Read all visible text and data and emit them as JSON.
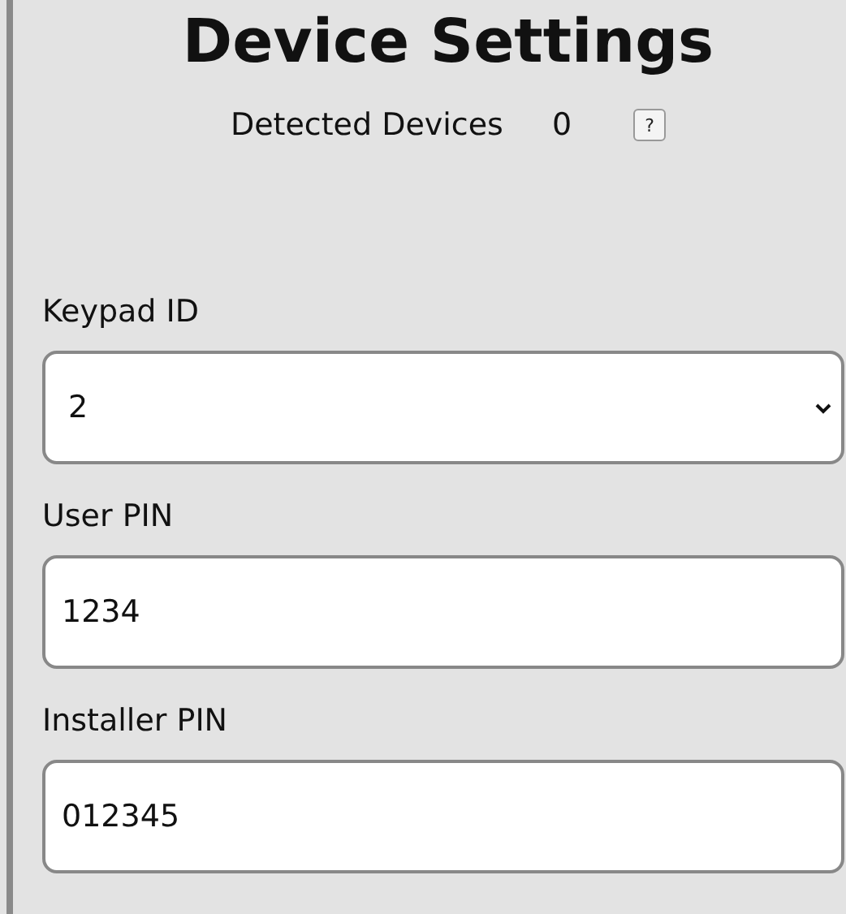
{
  "title": "Device Settings",
  "detected": {
    "label": "Detected Devices",
    "count": "0",
    "help": "?"
  },
  "fields": [
    {
      "kind": "select",
      "label": "Keypad ID",
      "value": "2"
    },
    {
      "kind": "text",
      "label": "User PIN",
      "value": "1234"
    },
    {
      "kind": "text",
      "label": "Installer PIN",
      "value": "012345"
    }
  ]
}
